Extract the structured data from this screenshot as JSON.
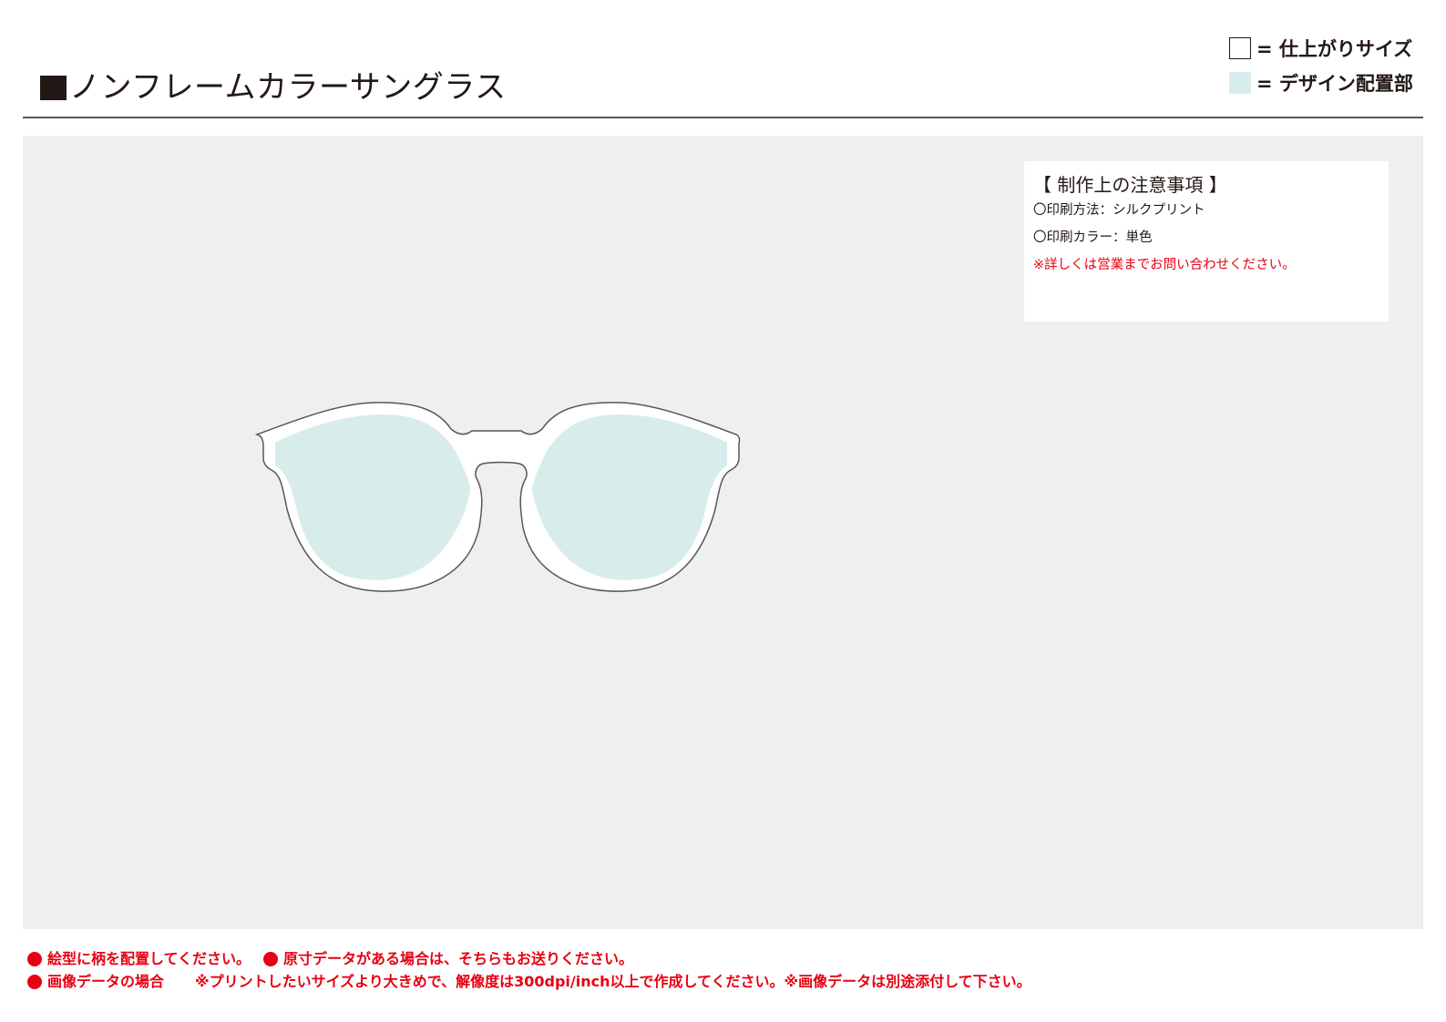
{
  "header": {
    "title": "ノンフレームカラーサングラス"
  },
  "legend": {
    "finish_size_label": "= 仕上がりサイズ",
    "design_area_label": "= デザイン配置部",
    "design_area_color": "#d8edeb"
  },
  "notes": {
    "title": "【 制作上の注意事項 】",
    "print_method": "〇印刷方法：シルクプリント",
    "print_color": "〇印刷カラー：単色",
    "warning": "※詳しくは営業までお問い合わせください。"
  },
  "footer": {
    "line1_a": "絵型に柄を配置してください。",
    "line1_b": "原寸データがある場合は、そちらもお送りください。",
    "line2_a": "画像データの場合",
    "line2_b": "※プリントしたいサイズより大きめで、解像度は300dpi/inch以上で作成してください。※画像データは別途添付して下さい。",
    "accent_color": "#e60012"
  }
}
